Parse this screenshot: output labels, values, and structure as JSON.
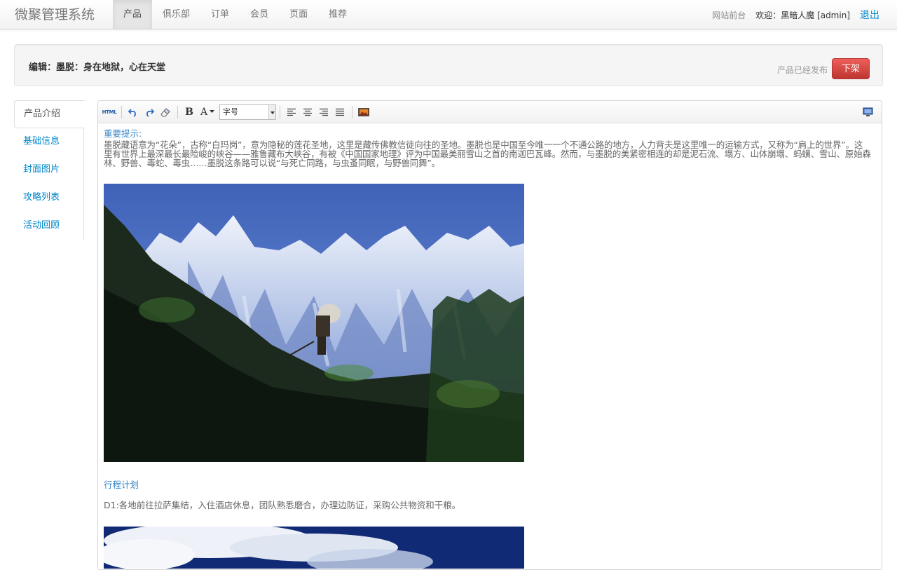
{
  "app": {
    "brand": "微聚管理系统"
  },
  "nav": {
    "items": [
      {
        "label": "产品"
      },
      {
        "label": "俱乐部"
      },
      {
        "label": "订单"
      },
      {
        "label": "会员"
      },
      {
        "label": "页面"
      },
      {
        "label": "推荐"
      }
    ],
    "active_index": 0
  },
  "user_bar": {
    "front_link": "网站前台",
    "welcome": "欢迎：黑暗人魔 [admin]",
    "logout": "退出"
  },
  "header": {
    "edit_title": "编辑：墨脱：身在地狱，心在天堂",
    "status": "产品已经发布",
    "offline_button": "下架"
  },
  "side_tabs": {
    "items": [
      {
        "label": "产品介绍"
      },
      {
        "label": "基础信息"
      },
      {
        "label": "封面图片"
      },
      {
        "label": "攻略列表"
      },
      {
        "label": "活动回顾"
      }
    ],
    "active_index": 0
  },
  "toolbar": {
    "html_icon_text": "HTML",
    "fontsize_placeholder": "字号",
    "icons": [
      "html-icon",
      "undo-icon",
      "redo-icon",
      "eraser-icon",
      "bold-icon",
      "font-color-icon",
      "align-left-icon",
      "align-center-icon",
      "align-right-icon",
      "align-justify-icon",
      "image-icon",
      "fullscreen-icon"
    ]
  },
  "content": {
    "heading": "重要提示:",
    "paragraph": "墨脱藏语意为“花朵”，古称“白玛岗”，意为隐秘的莲花圣地，这里是藏传佛教信徒向往的圣地。墨脱也是中国至今唯一一个不通公路的地方，人力背夫是这里唯一的运输方式，又称为“肩上的世界”。这里有世界上最深最长最险峻的峡谷——雅鲁藏布大峡谷，有被《中国国家地理》评为中国最美丽雪山之首的南迦巴瓦峰。然而，与墨脱的美紧密相连的却是泥石流、塌方、山体崩塌、蚂蟥、雪山、原始森林、野兽、毒蛇、毒虫……墨脱这条路可以说“与死亡同路，与虫蚤同眠，与野兽同舞”。",
    "itinerary_heading": "行程计划",
    "day1": "D1:各地前往拉萨集结，入住酒店休息，团队熟悉磨合，办理边防证，采购公共物资和干粮。"
  },
  "colors": {
    "link": "#0088cc",
    "danger": "#da4f49",
    "heading": "#3a87c8"
  }
}
